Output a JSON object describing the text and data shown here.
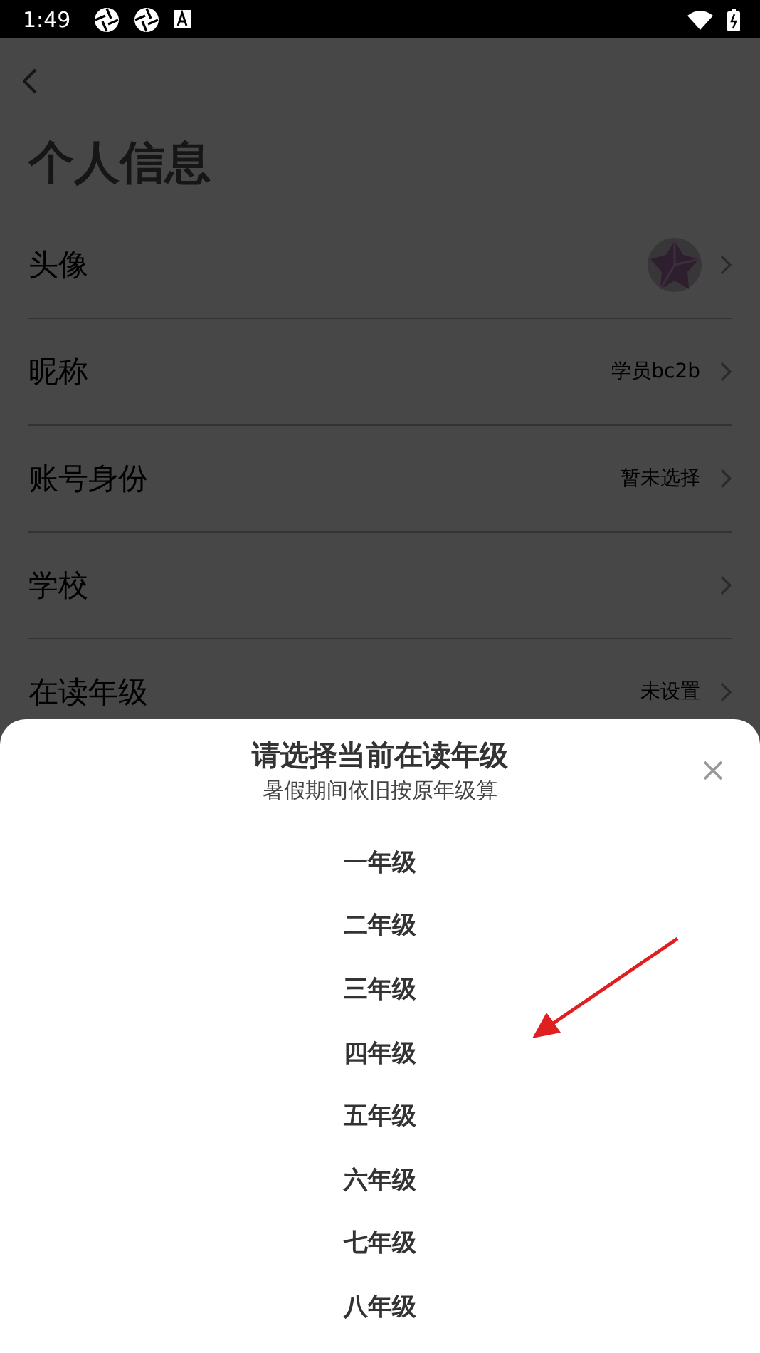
{
  "status_bar": {
    "time": "1:49"
  },
  "page": {
    "title": "个人信息"
  },
  "rows": [
    {
      "kind": "avatar",
      "label": "头像"
    },
    {
      "kind": "text",
      "label": "昵称",
      "value": "学员bc2b"
    },
    {
      "kind": "text",
      "label": "账号身份",
      "value": "暂未选择"
    },
    {
      "kind": "text",
      "label": "学校"
    },
    {
      "kind": "text",
      "label": "在读年级",
      "value": "未设置"
    }
  ],
  "sheet": {
    "title": "请选择当前在读年级",
    "subtitle": "暑假期间依旧按原年级算",
    "options": [
      "一年级",
      "二年级",
      "三年级",
      "四年级",
      "五年级",
      "六年级",
      "七年级",
      "八年级"
    ]
  }
}
